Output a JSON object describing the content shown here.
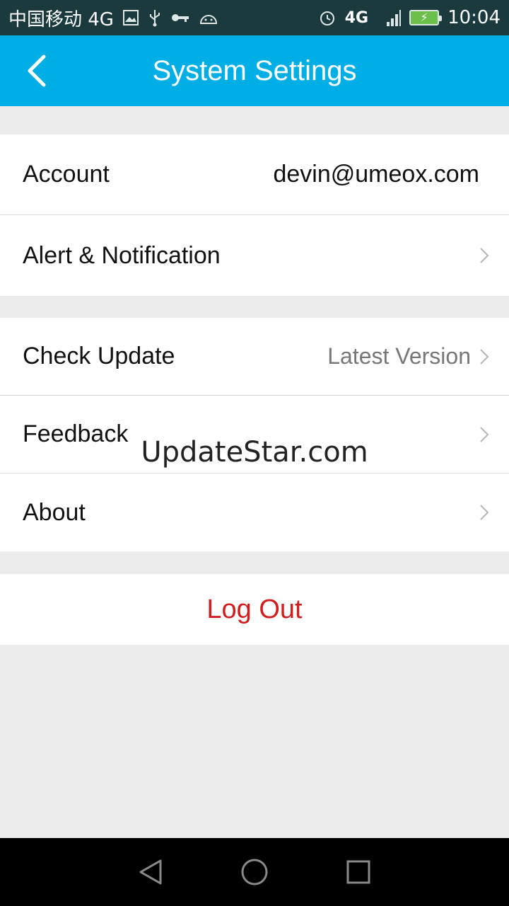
{
  "status_bar": {
    "carrier": "中国移动 4G",
    "time": "10:04",
    "network_label": "4G",
    "icons": [
      "gallery-icon",
      "usb-icon",
      "key-icon",
      "android-icon",
      "alarm-icon",
      "signal-icon",
      "battery-icon"
    ]
  },
  "header": {
    "title": "System Settings",
    "back_icon": "chevron-left-icon",
    "bg_color": "#00aee6"
  },
  "group1": {
    "account_label": "Account",
    "account_value": "devin@umeox.com",
    "alert_label": "Alert & Notification"
  },
  "group2": {
    "check_update_label": "Check Update",
    "check_update_value": "Latest Version",
    "feedback_label": "Feedback",
    "about_label": "About"
  },
  "logout": {
    "label": "Log Out",
    "color": "#d21d1d"
  },
  "watermark": "UpdateStar.com",
  "nav_bar": {
    "icons": [
      "nav-back-icon",
      "nav-home-icon",
      "nav-recents-icon"
    ]
  }
}
